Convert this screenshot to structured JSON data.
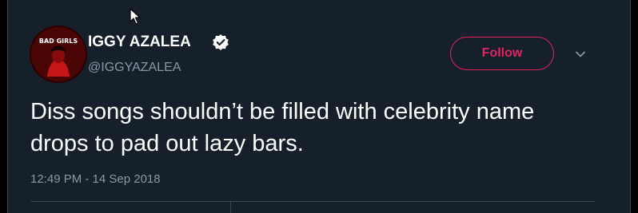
{
  "tweet": {
    "display_name": "IGGY AZALEA",
    "handle": "@IGGYAZALEA",
    "avatar_text": "BAD GIRLS",
    "follow_label": "Follow",
    "text": "Diss songs shouldn’t be filled with celebrity name drops to pad out lazy bars.",
    "timestamp": "12:49 PM - 14 Sep 2018"
  },
  "colors": {
    "background": "#15202b",
    "follow_accent": "#e0245e",
    "secondary_text": "#8899a6"
  },
  "icons": {
    "verified": "verified-badge-icon",
    "more": "chevron-down-icon",
    "cursor": "mouse-pointer-icon"
  }
}
